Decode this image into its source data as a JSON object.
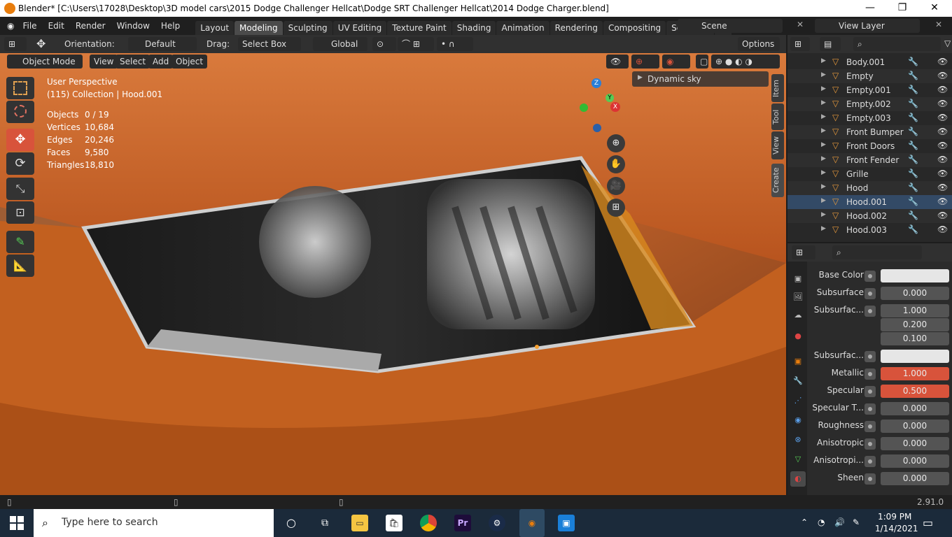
{
  "title": "Blender* [C:\\Users\\17028\\Desktop\\3D model cars\\2015 Dodge Challenger Hellcat\\Dodge SRT Challenger Hellcat\\2014 Dodge Charger.blend]",
  "menu": [
    "File",
    "Edit",
    "Render",
    "Window",
    "Help"
  ],
  "workspaces": [
    "Layout",
    "Modeling",
    "Sculpting",
    "UV Editing",
    "Texture Paint",
    "Shading",
    "Animation",
    "Rendering",
    "Compositing",
    "Scripting"
  ],
  "scene": "Scene",
  "view_layer": "View Layer",
  "toolbar": {
    "orientation_label": "Orientation:",
    "orientation_value": "Default",
    "drag_label": "Drag:",
    "drag_value": "Select Box",
    "transform_value": "Global",
    "options": "Options"
  },
  "viewport_header": {
    "mode": "Object Mode",
    "menus": [
      "View",
      "Select",
      "Add",
      "Object"
    ]
  },
  "overlay": {
    "perspective": "User Perspective",
    "collection": "(115) Collection | Hood.001",
    "stats": [
      {
        "label": "Objects",
        "value": "0 / 19"
      },
      {
        "label": "Vertices",
        "value": "10,684"
      },
      {
        "label": "Edges",
        "value": "20,246"
      },
      {
        "label": "Faces",
        "value": "9,580"
      },
      {
        "label": "Triangles",
        "value": "18,810"
      }
    ]
  },
  "gizmo": {
    "z": "Z",
    "y": "Y",
    "x": "X"
  },
  "dynamic_sky": "Dynamic sky",
  "side_tabs": [
    "Item",
    "Tool",
    "View",
    "Create"
  ],
  "outliner": [
    "Body.001",
    "Empty",
    "Empty.001",
    "Empty.002",
    "Empty.003",
    "Front Bumper",
    "Front Doors",
    "Front Fender",
    "Grille",
    "Hood",
    "Hood.001",
    "Hood.002",
    "Hood.003"
  ],
  "properties": [
    {
      "label": "Base Color",
      "value": "",
      "style": "white"
    },
    {
      "label": "Subsurface",
      "value": "0.000",
      "style": ""
    },
    {
      "label": "Subsurfac...",
      "value": "1.000",
      "style": ""
    },
    {
      "label": "",
      "value": "0.200",
      "style": ""
    },
    {
      "label": "",
      "value": "0.100",
      "style": ""
    },
    {
      "label": "Subsurfac...",
      "value": "",
      "style": "white"
    },
    {
      "label": "Metallic",
      "value": "1.000",
      "style": "hi"
    },
    {
      "label": "Specular",
      "value": "0.500",
      "style": "hi"
    },
    {
      "label": "Specular T...",
      "value": "0.000",
      "style": ""
    },
    {
      "label": "Roughness",
      "value": "0.000",
      "style": ""
    },
    {
      "label": "Anisotropic",
      "value": "0.000",
      "style": ""
    },
    {
      "label": "Anisotropi...",
      "value": "0.000",
      "style": ""
    },
    {
      "label": "Sheen",
      "value": "0.000",
      "style": ""
    }
  ],
  "version": "2.91.0",
  "taskbar": {
    "search": "Type here to search",
    "time": "1:09 PM",
    "date": "1/14/2021"
  }
}
